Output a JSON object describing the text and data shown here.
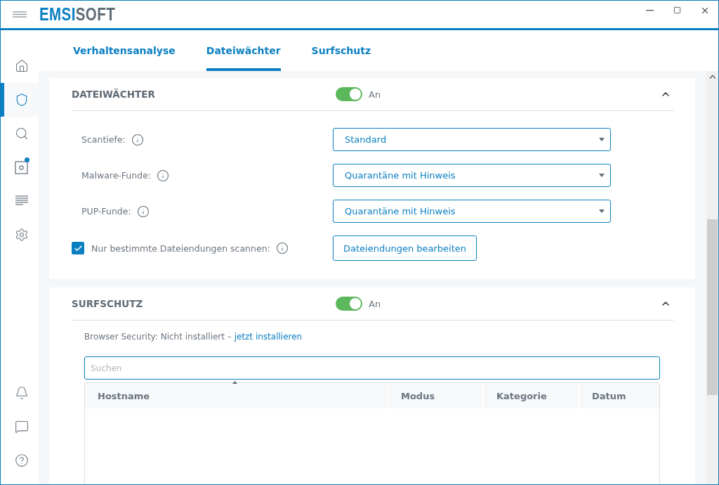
{
  "logo": {
    "accent": "EMSI",
    "rest": "SOFT"
  },
  "sidebar": {
    "items": [
      {
        "selected": false,
        "badge": false
      },
      {
        "selected": true,
        "badge": false
      },
      {
        "selected": false,
        "badge": false
      },
      {
        "selected": false,
        "badge": true
      },
      {
        "selected": false,
        "badge": false
      },
      {
        "selected": false,
        "badge": false
      }
    ]
  },
  "tabs": [
    {
      "label": "Verhaltensanalyse",
      "selected": false
    },
    {
      "label": "Dateiwächter",
      "selected": true
    },
    {
      "label": "Surfschutz",
      "selected": false
    }
  ],
  "file_guard": {
    "title": "DATEIWÄCHTER",
    "toggle": {
      "on": true,
      "label": "An"
    },
    "expanded": true,
    "rows": [
      {
        "kind": "select",
        "label": "Scantiefe:",
        "value": "Standard"
      },
      {
        "kind": "select",
        "label": "Malware-Funde:",
        "value": "Quarantäne mit Hinweis"
      },
      {
        "kind": "select",
        "label": "PUP-Funde:",
        "value": "Quarantäne mit Hinweis"
      },
      {
        "kind": "checkbox",
        "label": "Nur bestimmte Dateiendungen scannen:",
        "checked": true,
        "button": "Dateiendungen bearbeiten"
      }
    ]
  },
  "surf_protection": {
    "title": "SURFSCHUTZ",
    "toggle": {
      "on": true,
      "label": "An"
    },
    "expanded": true,
    "status_text": "Browser Security: Nicht installiert – ",
    "status_link": "jetzt installieren",
    "search": {
      "placeholder": "Suchen"
    },
    "table": {
      "columns": [
        {
          "label": "Hostname",
          "sorted": true
        },
        {
          "label": "Modus",
          "sorted": false
        },
        {
          "label": "Kategorie",
          "sorted": false
        },
        {
          "label": "Datum",
          "sorted": false
        }
      ]
    }
  }
}
